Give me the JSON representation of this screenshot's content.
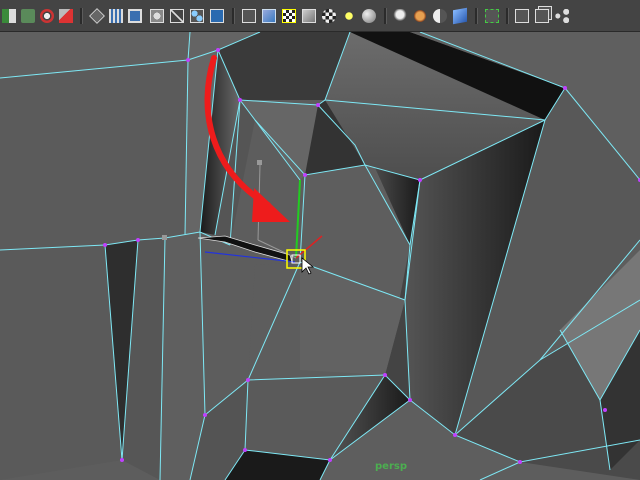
{
  "viewport": {
    "camera_label": "persp"
  },
  "colors": {
    "toolbar_bg": "#444444",
    "wire": "#7ee8f5",
    "vertex": "#c040ff",
    "annotation_arrow": "#ee1c1c",
    "selection": "#ffff00",
    "manip_y": "#22cc22",
    "manip_x": "#dd2222",
    "manip_z": "#2222dd"
  },
  "toolbar": {
    "icons": [
      "channel-box-icon",
      "paint-select-icon",
      "sculpt-icon",
      "paint-effects-icon",
      "wireframe-shade-icon",
      "grid-icon",
      "texture-icon",
      "xray-icon",
      "isolate-icon",
      "snap-icon",
      "cube-wire-icon",
      "cube-shaded-icon",
      "checker-cube-icon",
      "cube-outline-icon",
      "checker-icon",
      "light-yellow-icon",
      "sphere-gray-icon",
      "light-point-icon",
      "shadow-icon",
      "half-sphere-icon",
      "blue-cube-icon",
      "selection-highlight-icon",
      "cube-small-icon",
      "multi-cube-icon",
      "share-node-icon"
    ]
  }
}
